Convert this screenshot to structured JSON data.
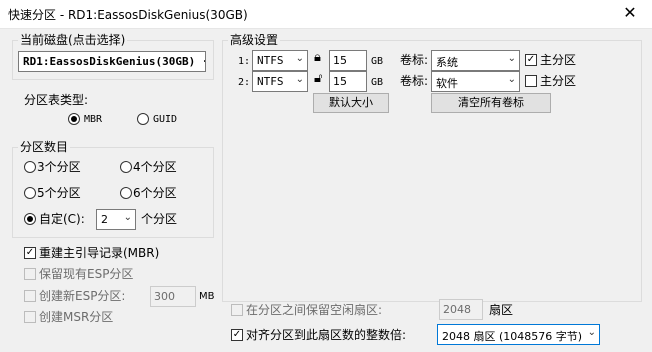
{
  "window": {
    "title": "快速分区 - RD1:EassosDiskGenius(30GB)",
    "close_glyph": "✕"
  },
  "current_disk": {
    "group_label": "当前磁盘(点击选择)",
    "value": "RD1:EassosDiskGenius(30GB) ·"
  },
  "partition_table": {
    "label": "分区表类型:",
    "options": [
      "MBR",
      "GUID"
    ],
    "selected": "MBR"
  },
  "partition_count": {
    "group_label": "分区数目",
    "options": [
      "3个分区",
      "4个分区",
      "5个分区",
      "6个分区"
    ],
    "custom_label": "自定(C):",
    "custom_value": "2",
    "suffix": "个分区",
    "selected": "custom"
  },
  "options": {
    "rebuild_mbr": {
      "label": "重建主引导记录(MBR)",
      "checked": true
    },
    "keep_esp": {
      "label": "保留现有ESP分区",
      "checked": false
    },
    "new_esp": {
      "label": "创建新ESP分区:",
      "value": "300",
      "unit": "MB",
      "checked": false
    },
    "create_msr": {
      "label": "创建MSR分区",
      "checked": false
    }
  },
  "advanced": {
    "group_label": "高级设置",
    "partitions": [
      {
        "index": "1:",
        "fs": "NTFS",
        "size": "15",
        "unit": "GB",
        "vol_label": "卷标:",
        "volume": "系统",
        "primary_label": "主分区",
        "primary": true,
        "lock_icon": "lock-icon"
      },
      {
        "index": "2:",
        "fs": "NTFS",
        "size": "15",
        "unit": "GB",
        "vol_label": "卷标:",
        "volume": "软件",
        "primary_label": "主分区",
        "primary": false,
        "lock_icon": "unlock-icon"
      }
    ],
    "default_size_button": "默认大小",
    "clear_labels_button": "清空所有卷标"
  },
  "free_space": {
    "label": "在分区之间保留空闲扇区:",
    "value": "2048",
    "unit": "扇区",
    "checked": false
  },
  "align": {
    "label": "对齐分区到此扇区数的整数倍:",
    "value": "2048 扇区 (1048576 字节)",
    "checked": true
  }
}
